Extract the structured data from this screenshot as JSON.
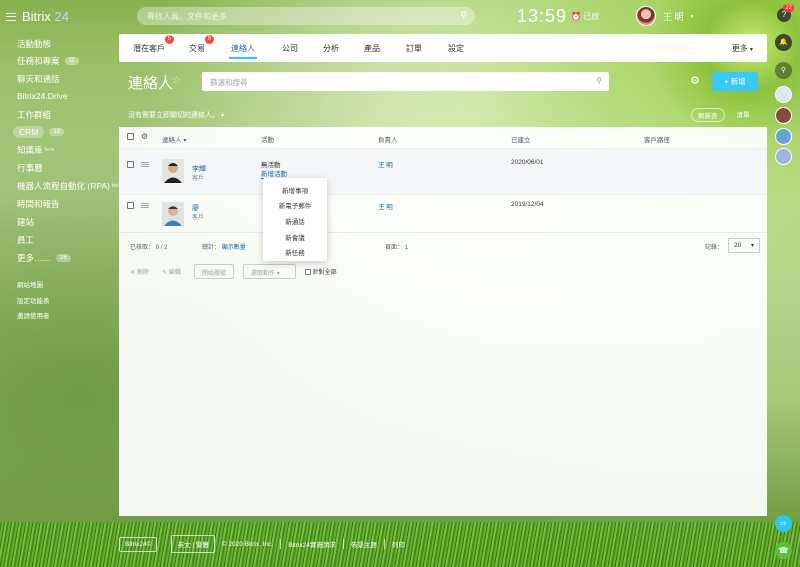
{
  "topbar": {
    "logo_text": "Bitrix",
    "logo_num": "24",
    "search_placeholder": "尋找人員、文件和更多",
    "clock": "13:59",
    "alarm_label": "已啟",
    "user_name": "王 明",
    "help_badge": "22"
  },
  "sidebar": {
    "items": [
      {
        "label": "活動動態"
      },
      {
        "label": "任務和專案",
        "count": "11"
      },
      {
        "label": "聊天和通話"
      },
      {
        "label": "Bitrix24.Drive"
      },
      {
        "label": "工作群組"
      },
      {
        "label": "CRM",
        "count": "13"
      },
      {
        "label": "知識庫",
        "tag": "beta"
      },
      {
        "label": "行事曆"
      },
      {
        "label": "機器人流程自動化 (RPA)",
        "tag": "beta"
      },
      {
        "label": "時間和報告"
      },
      {
        "label": "建站"
      },
      {
        "label": "員工"
      },
      {
        "label": "更多……",
        "count": "26"
      }
    ],
    "small_links": [
      "網站地圖",
      "設定功能表",
      "邀請使用者"
    ]
  },
  "tabs": [
    {
      "label": "潛在客戶",
      "badge": "5"
    },
    {
      "label": "交易",
      "badge": "8"
    },
    {
      "label": "連絡人"
    },
    {
      "label": "公司"
    },
    {
      "label": "分析"
    },
    {
      "label": "產品"
    },
    {
      "label": "訂單"
    },
    {
      "label": "設定"
    }
  ],
  "more_label": "更多",
  "page": {
    "title": "連絡人",
    "filter_placeholder": "篩選和搜尋",
    "add_button": "新增",
    "notice": "沒有需要立即關切的連絡人。",
    "view_buttons": [
      "刷新表",
      "清單"
    ]
  },
  "table": {
    "headers": [
      "連絡人",
      "活動",
      "負責人",
      "已建立",
      "客戶路徑"
    ],
    "rows": [
      {
        "name": "李輝",
        "type": "客戶",
        "activity": "無活動",
        "activity_link": "新增活動",
        "owner": "王 明",
        "created": "2020/06/01"
      },
      {
        "name": "廖",
        "type": "客戶",
        "activity": "",
        "activity_link": "",
        "owner": "王 明",
        "created": "2019/12/04"
      }
    ],
    "activity_menu": [
      "新增事項",
      "新電子郵件",
      "新通話",
      "新會議",
      "新任務"
    ],
    "footer": {
      "selected_label": "已核取：",
      "selected_value": "0 / 2",
      "total_label": "總計：",
      "total_link": "顯示數量",
      "page_label": "頁面：",
      "page_value": "1",
      "records_label": "記錄：",
      "records_value": "20"
    },
    "actions": {
      "delete": "刪除",
      "edit": "編輯",
      "start_dialog": "開始撥號",
      "choose_action": "選取動作",
      "apply_all": "針對全部"
    }
  },
  "bottom": {
    "items": [
      "Bitrix24©",
      "英文 | 繁體",
      "© 2020 Bitrix, Inc.",
      "Bitrix24實施請求",
      "佈景主題",
      "列印"
    ]
  },
  "colors": {
    "accent": "#2fc6f6",
    "link": "#2067b0",
    "badge": "#f44336"
  }
}
